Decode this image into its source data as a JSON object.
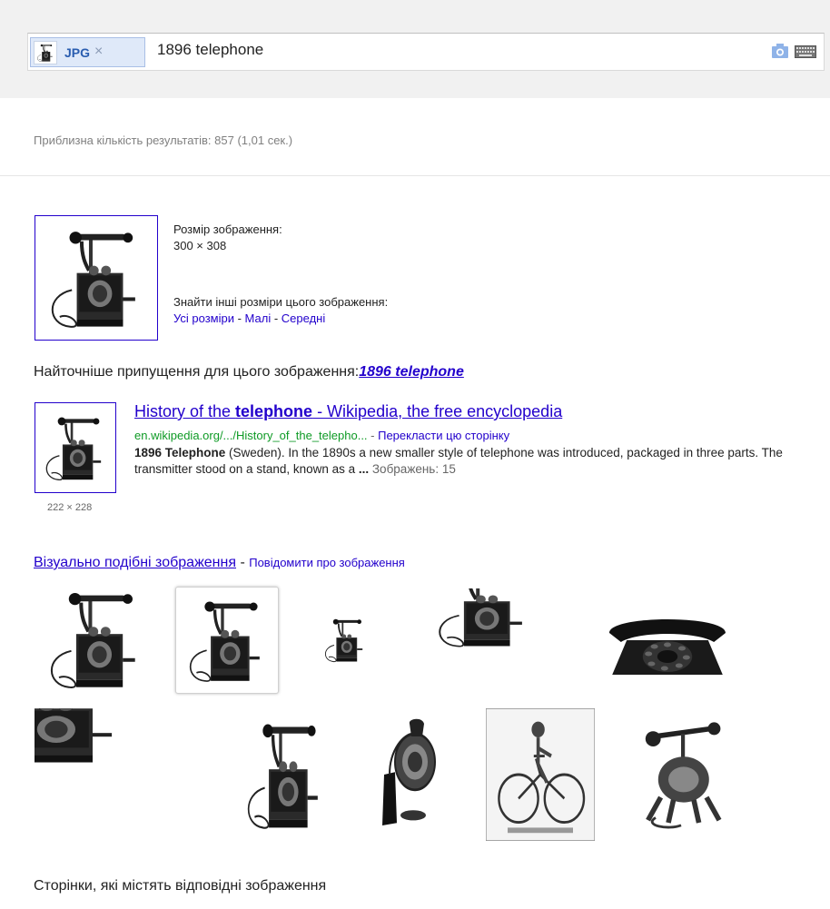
{
  "search": {
    "chip_label": "JPG",
    "chip_close": "×",
    "query": "1896 telephone"
  },
  "stats": "Приблизна кількість результатів: 857 (1,01 сек.)",
  "image_info": {
    "size_label": "Розмір зображення:",
    "size_value": "300 × 308",
    "other_sizes_label": "Знайти інші розміри цього зображення:",
    "links": [
      "Усі розміри",
      "Малі",
      "Середні"
    ],
    "link_sep": " - "
  },
  "best_guess": {
    "label": "Найточніше припущення для цього зображення:",
    "term": "1896 telephone"
  },
  "result": {
    "title_prefix": "History of the ",
    "title_bold": "telephone",
    "title_suffix": " - Wikipedia, the free encyclopedia",
    "url": "en.wikipedia.org/.../History_of_the_telepho...",
    "url_sep": " - ",
    "translate": "Перекласти цю сторінку",
    "snippet_bold": "1896 Telephone",
    "snippet_text": " (Sweden). In the 1890s a new smaller style of telephone was introduced, packaged in three parts. The transmitter stood on a stand, known as a ",
    "snippet_ellipsis": "...",
    "images_count": " Зображень: 15",
    "thumb_dim": "222 × 228"
  },
  "similar": {
    "label": "Візуально подібні зображення",
    "sep": " - ",
    "report": "Повідомити про зображення"
  },
  "pages_header": "Сторінки, які містять відповідні зображення",
  "colors": {
    "link": "#2200cc",
    "url_green": "#0e9a25",
    "band": "#f1f1f1"
  }
}
